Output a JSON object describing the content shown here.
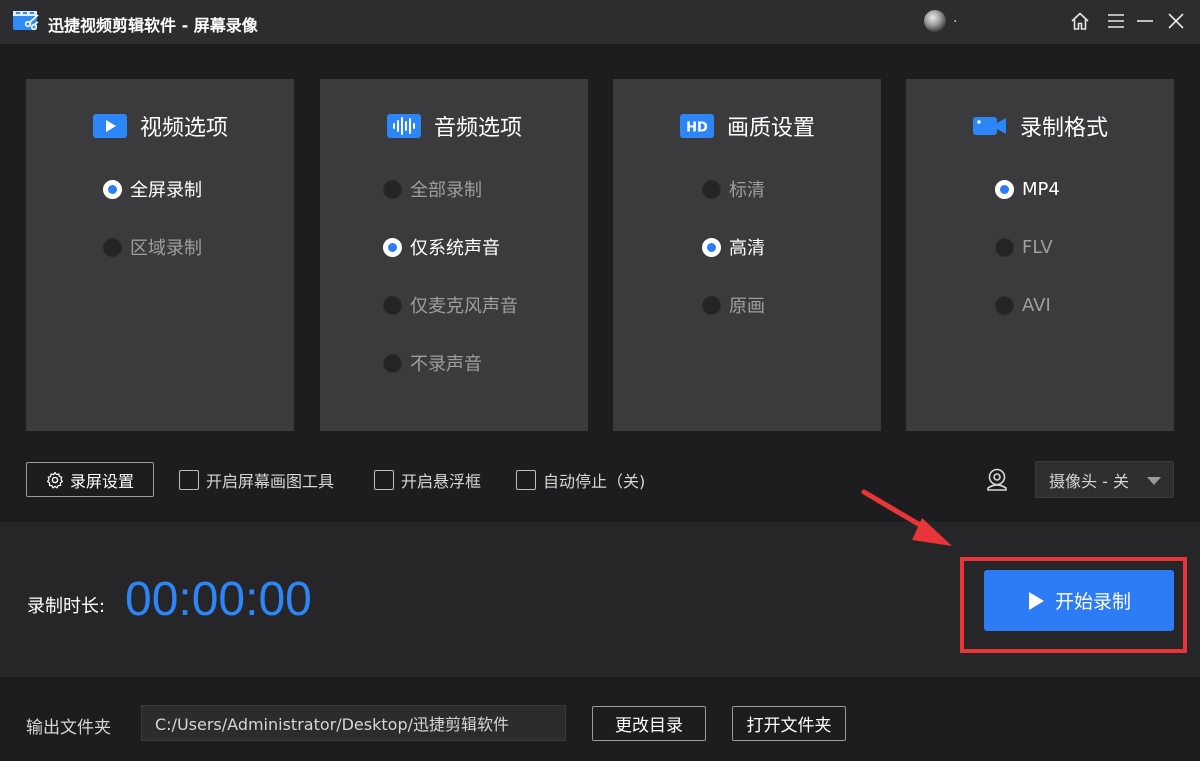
{
  "window": {
    "title": "迅捷视频剪辑软件 - 屏幕录像",
    "username": "."
  },
  "panels": [
    {
      "title": "视频选项",
      "icon": "video-icon",
      "options": [
        {
          "label": "全屏录制",
          "selected": true
        },
        {
          "label": "区域录制",
          "selected": false
        }
      ]
    },
    {
      "title": "音频选项",
      "icon": "audio-wave-icon",
      "options": [
        {
          "label": "全部录制",
          "selected": false
        },
        {
          "label": "仅系统声音",
          "selected": true
        },
        {
          "label": "仅麦克风声音",
          "selected": false
        },
        {
          "label": "不录声音",
          "selected": false
        }
      ]
    },
    {
      "title": "画质设置",
      "icon": "hd-icon",
      "icon_text": "HD",
      "options": [
        {
          "label": "标清",
          "selected": false
        },
        {
          "label": "高清",
          "selected": true
        },
        {
          "label": "原画",
          "selected": false
        }
      ]
    },
    {
      "title": "录制格式",
      "icon": "camera-icon",
      "options": [
        {
          "label": "MP4",
          "selected": true
        },
        {
          "label": "FLV",
          "selected": false
        },
        {
          "label": "AVI",
          "selected": false
        }
      ]
    }
  ],
  "settings": {
    "settings_button": "录屏设置",
    "checkboxes": [
      {
        "label": "开启屏幕画图工具",
        "checked": false
      },
      {
        "label": "开启悬浮框",
        "checked": false
      },
      {
        "label": "自动停止（关)",
        "checked": false
      }
    ],
    "camera_select": "摄像头 - 关"
  },
  "recording": {
    "duration_label": "录制时长:",
    "duration_value": "00:00:00",
    "start_button": "开始录制"
  },
  "output": {
    "label": "输出文件夹",
    "path": "C:/Users/Administrator/Desktop/迅捷剪辑软件",
    "change_dir_button": "更改目录",
    "open_folder_button": "打开文件夹"
  },
  "colors": {
    "accent": "#2d7cf6",
    "timer": "#2d86f7",
    "highlight_frame": "#e8353a",
    "panel_bg": "#3b3b3d",
    "window_bg": "#1d1d1f"
  }
}
